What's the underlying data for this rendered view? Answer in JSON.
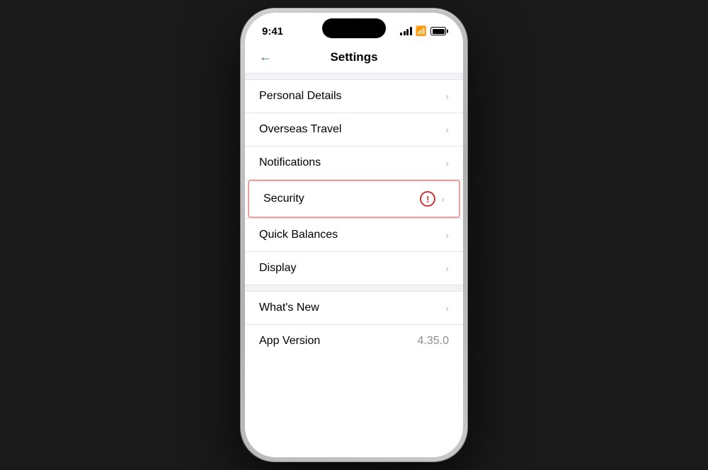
{
  "status_bar": {
    "time": "9:41"
  },
  "header": {
    "back_label": "←",
    "title": "Settings"
  },
  "menu_items": [
    {
      "id": "personal-details",
      "label": "Personal Details",
      "has_warning": false
    },
    {
      "id": "overseas-travel",
      "label": "Overseas Travel",
      "has_warning": false
    },
    {
      "id": "notifications",
      "label": "Notifications",
      "has_warning": false
    },
    {
      "id": "security",
      "label": "Security",
      "has_warning": true
    },
    {
      "id": "quick-balances",
      "label": "Quick Balances",
      "has_warning": false
    },
    {
      "id": "display",
      "label": "Display",
      "has_warning": false
    }
  ],
  "section2_items": [
    {
      "id": "whats-new",
      "label": "What's New",
      "has_warning": false
    }
  ],
  "version_row": {
    "label": "App Version",
    "value": "4.35.0"
  },
  "chevron": "›",
  "warning_symbol": "!"
}
